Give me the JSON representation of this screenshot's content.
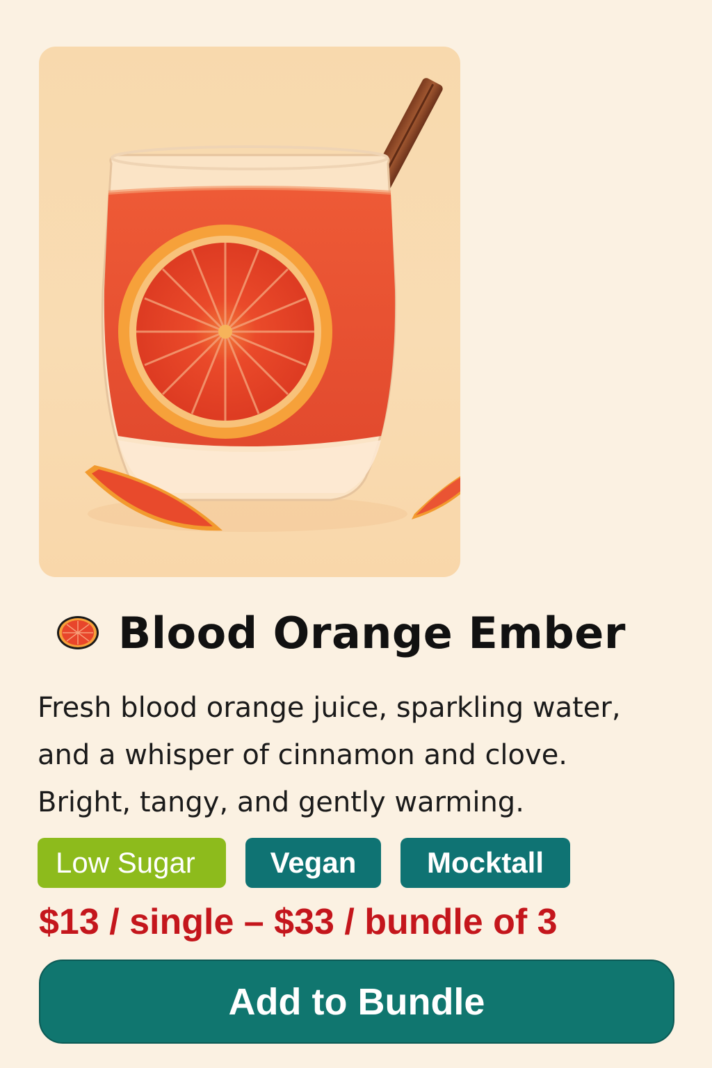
{
  "product": {
    "name": "Blood Orange Ember",
    "description_lines": [
      "Fresh blood orange juice, sparkling water,",
      "and a whisper of cinnamon and clove.",
      "Bright, tangy, and gently warming."
    ],
    "tags": [
      "Low Sugar",
      "Vegan",
      "Mocktall"
    ],
    "price": "$13 / single – $33 / bundle of 3",
    "cta_label": "Add to Bundle",
    "title_icon": "blood-orange-slice-icon"
  },
  "colors": {
    "background": "#fbf1e2",
    "price": "#c4161c",
    "teal": "#0f7373",
    "lime": "#8dbb1c"
  }
}
